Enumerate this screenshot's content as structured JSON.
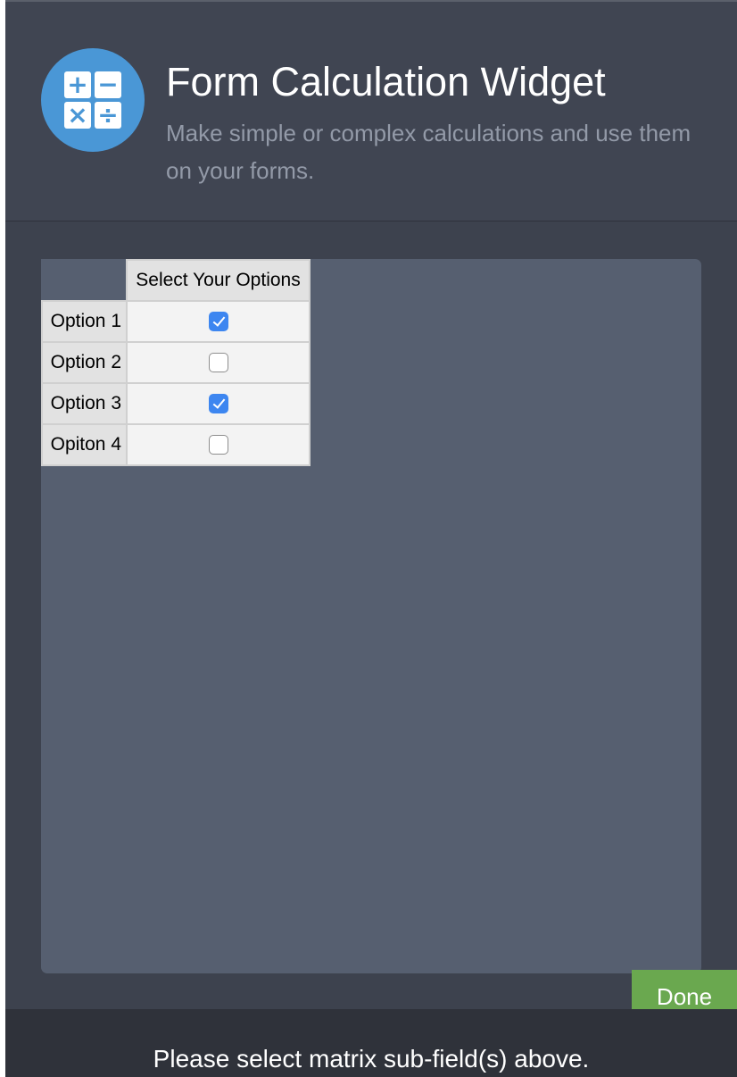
{
  "widget": {
    "title": "Form Calculation Widget",
    "subtitle": "Make simple or complex calculations and use them on your forms.",
    "logo_icon": "calculator-icon",
    "logo_symbols": [
      "+",
      "−",
      "×",
      "÷"
    ],
    "accent_color": "#4a97d6"
  },
  "matrix": {
    "column_header": "Select Your Options",
    "rows": [
      {
        "label": "Option 1",
        "checked": true
      },
      {
        "label": "Option 2",
        "checked": false
      },
      {
        "label": "Option 3",
        "checked": true
      },
      {
        "label": "Opiton 4",
        "checked": false
      }
    ],
    "checkbox_color": "#3d86f0"
  },
  "actions": {
    "done_label": "Done",
    "done_color": "#6aa84f"
  },
  "footer": {
    "message": "Please select matrix sub-field(s) above."
  }
}
